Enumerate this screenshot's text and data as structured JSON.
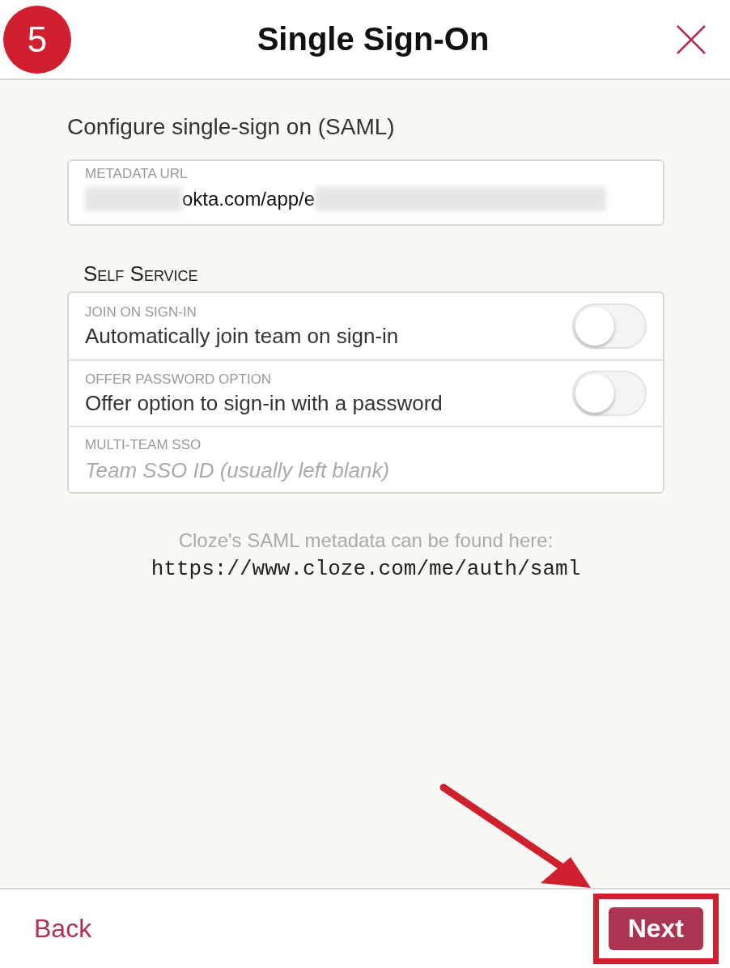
{
  "header": {
    "step": "5",
    "title": "Single Sign-On"
  },
  "heading": "Configure single-sign on (SAML)",
  "metadata_field": {
    "label": "METADATA URL",
    "value": "okta.com/app/e"
  },
  "section_title": "Self Service",
  "options": [
    {
      "kind": "toggle",
      "label": "JOIN ON SIGN-IN",
      "text": "Automatically join team on sign-in",
      "on": false
    },
    {
      "kind": "toggle",
      "label": "OFFER PASSWORD OPTION",
      "text": "Offer option to sign-in with a password",
      "on": false
    },
    {
      "kind": "field",
      "label": "MULTI-TEAM SSO",
      "placeholder": "Team SSO ID (usually left blank)"
    }
  ],
  "note": "Cloze's SAML metadata can be found here:",
  "note_url": "https://www.cloze.com/me/auth/saml",
  "footer": {
    "back": "Back",
    "next": "Next"
  }
}
